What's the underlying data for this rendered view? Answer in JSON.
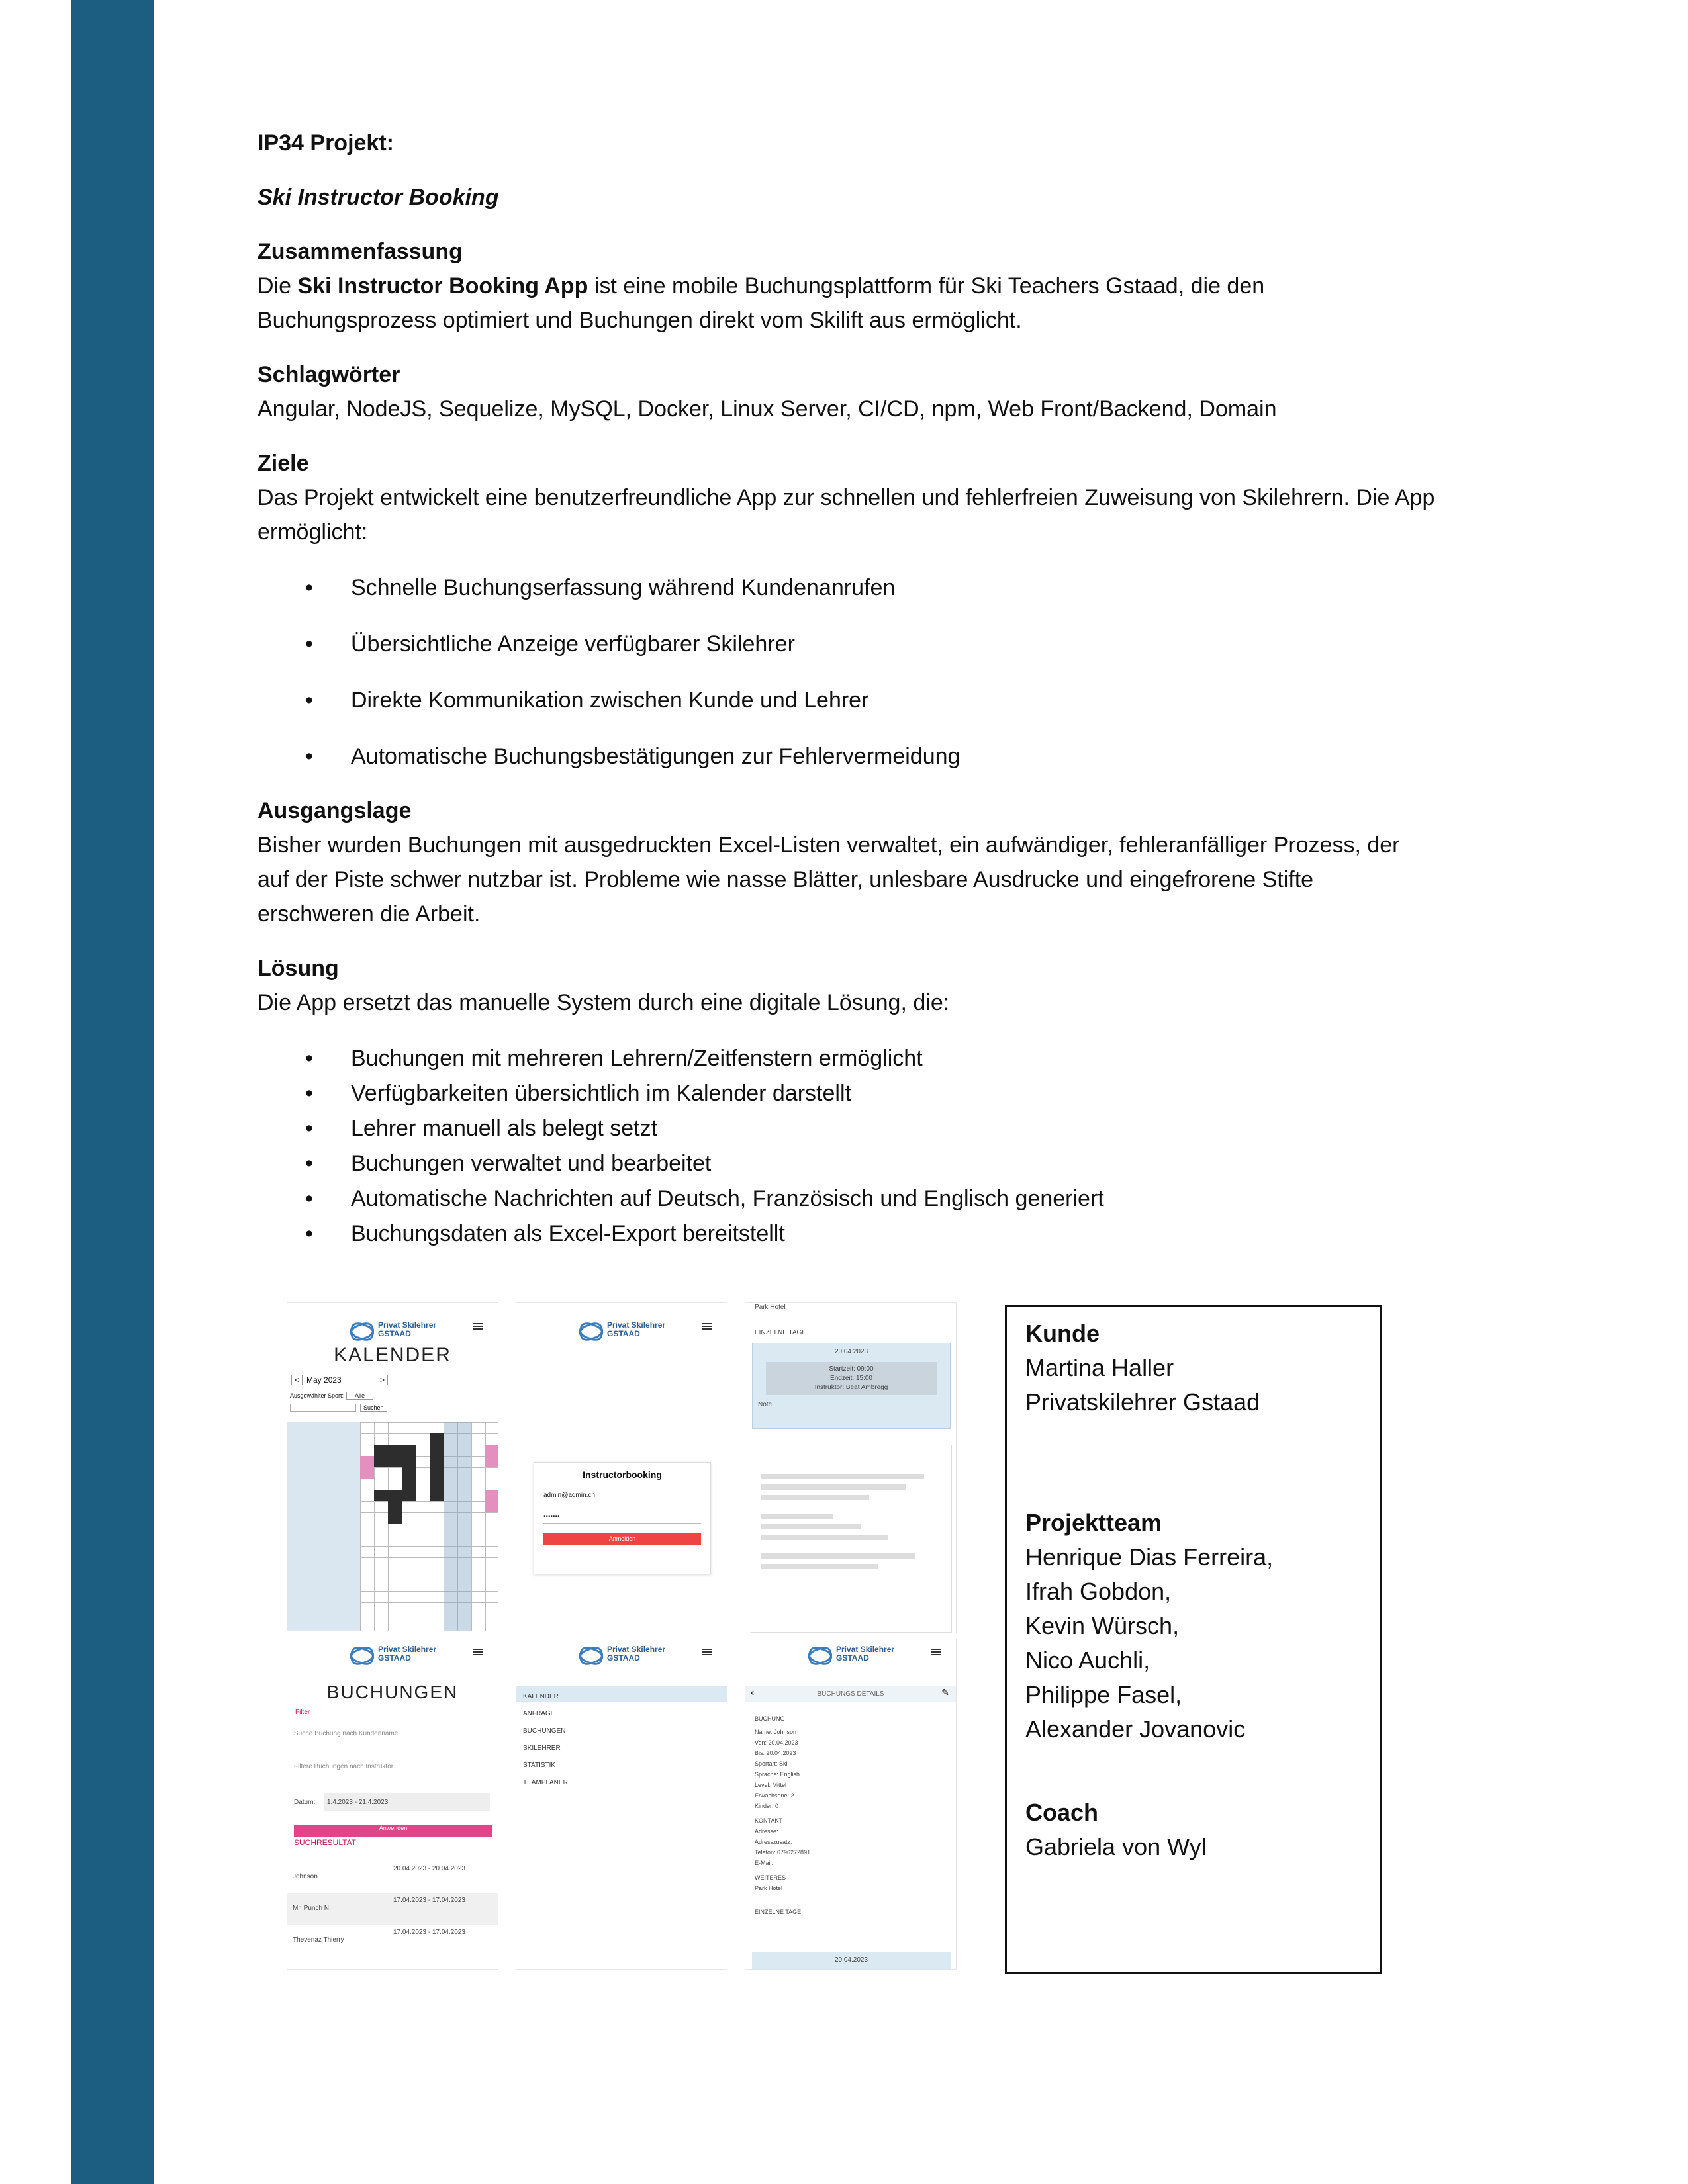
{
  "doc": {
    "title": "IP34 Projekt:",
    "subtitle": "Ski Instructor Booking",
    "summary": {
      "heading": "Zusammenfassung",
      "prefix": "Die ",
      "bold": "Ski Instructor Booking App",
      "rest": " ist eine mobile Buchungsplattform für Ski Teachers Gstaad, die den Buchungsprozess optimiert und Buchungen direkt vom Skilift aus ermöglicht."
    },
    "keywords": {
      "heading": "Schlagwörter",
      "text": "Angular, NodeJS, Sequelize, MySQL, Docker, Linux Server, CI/CD, npm, Web Front/Backend, Domain"
    },
    "goals": {
      "heading": "Ziele",
      "text": "Das Projekt entwickelt eine benutzerfreundliche App zur schnellen und fehlerfreien Zuweisung von Skilehrern. Die App ermöglicht:",
      "items": [
        "Schnelle Buchungserfassung während Kundenanrufen",
        "Übersichtliche Anzeige verfügbarer Skilehrer",
        "Direkte Kommunikation zwischen Kunde und Lehrer",
        "Automatische Buchungsbestätigungen zur Fehlervermeidung"
      ]
    },
    "situation": {
      "heading": "Ausgangslage",
      "text": "Bisher wurden Buchungen mit ausgedruckten Excel-Listen verwaltet, ein aufwändiger, fehleranfälliger Prozess, der auf der Piste schwer nutzbar ist. Probleme wie nasse Blätter, unlesbare Ausdrucke und eingefrorene Stifte erschweren die Arbeit."
    },
    "solution": {
      "heading": "Lösung",
      "text": "Die App ersetzt das manuelle System durch eine digitale Lösung, die:",
      "items": [
        "Buchungen mit mehreren Lehrern/Zeitfenstern ermöglicht",
        "Verfügbarkeiten übersichtlich im Kalender darstellt",
        "Lehrer manuell als belegt setzt",
        "Buchungen verwaltet und bearbeitet",
        "Automatische Nachrichten auf Deutsch, Französisch und Englisch generiert",
        "Buchungsdaten als Excel-Export bereitstellt"
      ]
    }
  },
  "screens": {
    "logo": "Privat Skilehrer GSTAAD",
    "calendar": {
      "heading": "KALENDER",
      "month": "May 2023",
      "sport_label": "Ausgewählter Sport:",
      "sport_value": "Alle",
      "search_btn": "Suchen",
      "prev": "<",
      "next": ">"
    },
    "login": {
      "heading": "Instructorbooking",
      "user": "admin@admin.ch",
      "password": "•••••••",
      "button": "Anmelden"
    },
    "detail_top": {
      "hotel": "Park Hotel",
      "days_label": "EINZELNE TAGE",
      "date": "20.04.2023",
      "start": "Startzeit: 09:00",
      "end": "Endzeit: 15:00",
      "instructor": "Instruktor: Beat Ambrogg",
      "note": "Note:"
    },
    "bookings": {
      "heading": "BUCHUNGEN",
      "filter": "Filter",
      "search_placeholder": "Suche Buchung nach Kundenname",
      "teacher_placeholder": "Filtere Buchungen nach Instruktor",
      "date_label": "Datum:",
      "date_value": "1.4.2023 - 21.4.2023",
      "apply": "Anwenden",
      "results": "SUCHRESULTAT",
      "rows": [
        {
          "name": "Johnson",
          "dates": "20.04.2023 - 20.04.2023"
        },
        {
          "name": "Mr. Punch N.",
          "dates": "17.04.2023 - 17.04.2023"
        },
        {
          "name": "Thevenaz Thierry",
          "dates": "17.04.2023 - 17.04.2023"
        }
      ]
    },
    "menu": {
      "items": [
        "KALENDER",
        "ANFRAGE",
        "BUCHUNGEN",
        "SKILEHRER",
        "STATISTIK",
        "TEAMPLANER"
      ]
    },
    "detail": {
      "heading": "BUCHUNGS DETAILS",
      "section": "BUCHUNG",
      "lines": [
        "Name: Johnson",
        "Von: 20.04.2023",
        "Bis: 20.04.2023",
        "Sportart: Ski",
        "Sprache: English",
        "Level: Mittel",
        "Erwachsene: 2",
        "Kinder: 0"
      ],
      "contact": "KONTAKT",
      "contact_lines": [
        "Adresse:",
        "Adresszusatz:",
        "Telefon: 0796272891",
        "E-Mail:"
      ],
      "more": "WEITERES",
      "hotel": "Park Hotel",
      "days_label": "EINZELNE TAGE",
      "date": "20.04.2023"
    }
  },
  "info": {
    "client_heading": "Kunde",
    "client_lines": [
      "Martina Haller",
      "Privatskilehrer Gstaad"
    ],
    "team_heading": "Projektteam",
    "team": [
      "Henrique Dias Ferreira,",
      "Ifrah Gobdon,",
      "Kevin Würsch,",
      "Nico Auchli,",
      "Philippe Fasel,",
      "Alexander Jovanovic"
    ],
    "coach_heading": "Coach",
    "coach": "Gabriela von Wyl"
  },
  "colors": {
    "sidebar": "#1b5e82",
    "accent_pink": "#e0458a",
    "button_red": "#ef4444"
  }
}
